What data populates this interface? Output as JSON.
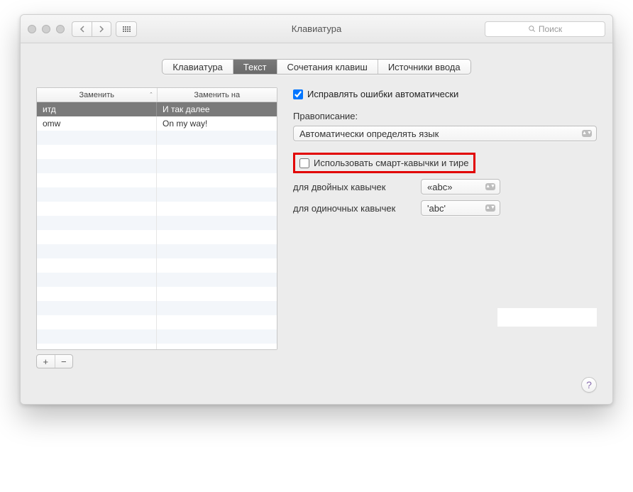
{
  "window": {
    "title": "Клавиатура",
    "search_placeholder": "Поиск"
  },
  "tabs": {
    "items": [
      "Клавиатура",
      "Текст",
      "Сочетания клавиш",
      "Источники ввода"
    ],
    "active_index": 1
  },
  "table": {
    "col_replace": "Заменить",
    "col_with": "Заменить на",
    "rows": [
      {
        "replace": "итд",
        "with": "И так далее",
        "selected": true
      },
      {
        "replace": "omw",
        "with": "On my way!",
        "selected": false
      }
    ]
  },
  "buttons": {
    "add": "+",
    "remove": "−"
  },
  "options": {
    "autocorrect_label": "Исправлять ошибки автоматически",
    "autocorrect_checked": true,
    "spelling_label": "Правописание:",
    "spelling_value": "Автоматически определять язык",
    "smart_quotes_label": "Использовать смарт-кавычки и тире",
    "smart_quotes_checked": false,
    "double_quotes_label": "для двойных кавычек",
    "double_quotes_value": "«abc»",
    "single_quotes_label": "для одиночных кавычек",
    "single_quotes_value": "'abc'"
  },
  "help": "?"
}
